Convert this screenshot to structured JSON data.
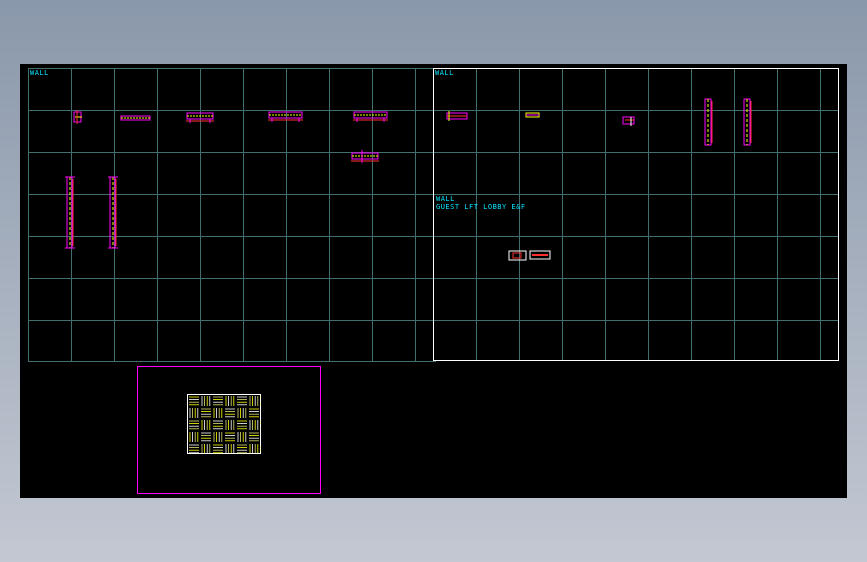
{
  "left_grid": {
    "label": "WALL"
  },
  "right_grid": {
    "label": "WALL",
    "sublabel_1": "WALL",
    "sublabel_2": "GUEST LFT LOBBY E&F"
  },
  "colors": {
    "background": "#000000",
    "grid_line": "#3f6f6f",
    "label": "#00e5ff",
    "magenta": "#ff00ff",
    "yellow": "#ffff00",
    "red": "#ff3030",
    "white": "#ffffff"
  }
}
